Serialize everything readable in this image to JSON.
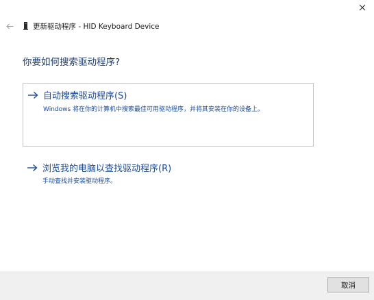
{
  "window": {
    "title": "更新驱动程序 - HID Keyboard Device",
    "close_icon": "close-icon",
    "back_icon": "back-arrow-icon",
    "device_icon": "keyboard-device-icon"
  },
  "main": {
    "heading": "你要如何搜索驱动程序?",
    "options": [
      {
        "title": "自动搜索驱动程序(S)",
        "description": "Windows 将在你的计算机中搜索最佳可用驱动程序，并将其安装在你的设备上。",
        "icon": "arrow-right-icon"
      },
      {
        "title": "浏览我的电脑以查找驱动程序(R)",
        "description": "手动查找并安装驱动程序。",
        "icon": "arrow-right-icon"
      }
    ]
  },
  "footer": {
    "cancel_label": "取消"
  },
  "colors": {
    "accent": "#1a4a9c",
    "heading": "#1f3d6f",
    "option_border": "#a9cde3",
    "footer_bg": "#f0f0f0"
  }
}
